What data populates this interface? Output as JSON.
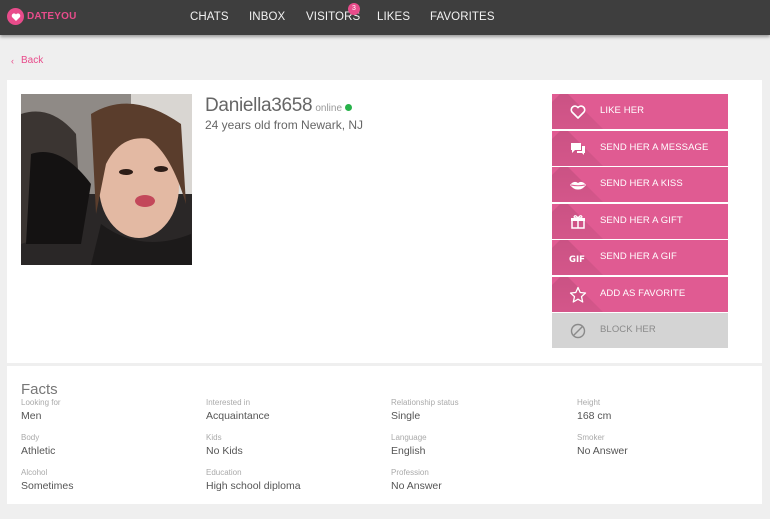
{
  "brand": {
    "logo_text": "DATEYOU",
    "accent_color": "#e84c8b"
  },
  "nav": {
    "items": [
      {
        "label": "CHATS"
      },
      {
        "label": "INBOX"
      },
      {
        "label": "VISITORS",
        "badge": "3"
      },
      {
        "label": "LIKES"
      },
      {
        "label": "FAVORITES"
      }
    ]
  },
  "back": {
    "label": "Back",
    "icon": "chevron-left-icon"
  },
  "profile": {
    "username": "Daniella3658",
    "status": "online",
    "status_color": "#27b24a",
    "subtitle": "24 years old from Newark, NJ"
  },
  "actions": [
    {
      "label": "LIKE HER",
      "icon": "heart-icon"
    },
    {
      "label": "SEND HER A MESSAGE",
      "icon": "chat-bubbles-icon"
    },
    {
      "label": "SEND HER A KISS",
      "icon": "lips-icon"
    },
    {
      "label": "SEND HER A GIFT",
      "icon": "gift-icon"
    },
    {
      "label": "SEND HER A GIF",
      "icon": "gif-icon"
    },
    {
      "label": "ADD AS FAVORITE",
      "icon": "star-icon"
    },
    {
      "label": "BLOCK HER",
      "icon": "block-icon"
    }
  ],
  "facts": {
    "title": "Facts",
    "items": [
      {
        "label": "Looking for",
        "value": "Men"
      },
      {
        "label": "Interested in",
        "value": "Acquaintance"
      },
      {
        "label": "Relationship status",
        "value": "Single"
      },
      {
        "label": "Height",
        "value": "168 cm"
      },
      {
        "label": "Body",
        "value": "Athletic"
      },
      {
        "label": "Kids",
        "value": "No Kids"
      },
      {
        "label": "Language",
        "value": "English"
      },
      {
        "label": "Smoker",
        "value": "No Answer"
      },
      {
        "label": "Alcohol",
        "value": "Sometimes"
      },
      {
        "label": "Education",
        "value": "High school diploma"
      },
      {
        "label": "Profession",
        "value": "No Answer"
      }
    ]
  }
}
